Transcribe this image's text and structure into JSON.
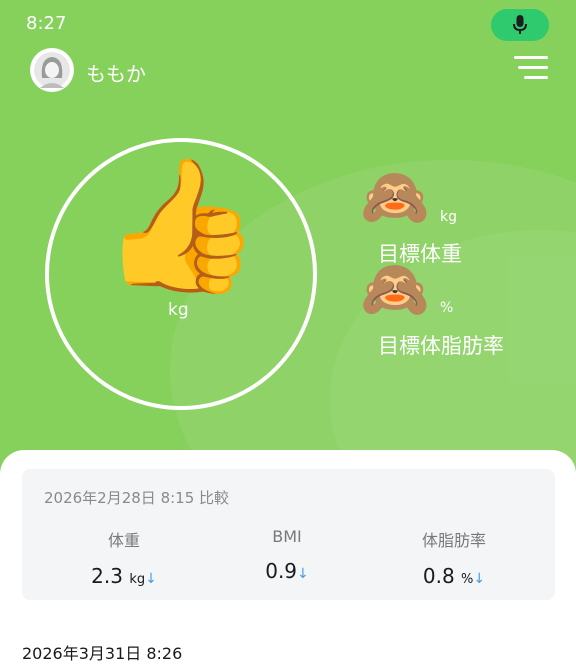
{
  "status": {
    "time": "8:27"
  },
  "header": {
    "user_name": "ももか"
  },
  "summary": {
    "unit": "kg"
  },
  "goals": {
    "weight": {
      "unit": "kg",
      "label": "目標体重"
    },
    "body_fat": {
      "unit": "%",
      "label": "目標体脂肪率"
    }
  },
  "comparison": {
    "date_text": "2026年2月28日 8:15 比較",
    "items": [
      {
        "label": "体重",
        "value": "2.3",
        "unit": "kg",
        "arrow": "↓"
      },
      {
        "label": "BMI",
        "value": "0.9",
        "unit": "",
        "arrow": "↓"
      },
      {
        "label": "体脂肪率",
        "value": "0.8",
        "unit": "%",
        "arrow": "↓"
      }
    ]
  },
  "latest": {
    "date_text": "2026年3月31日 8:26"
  },
  "icons": {
    "center": "thumbs-up-icon",
    "goals": "see-no-evil-monkey-icon",
    "mic": "microphone-icon",
    "menu": "menu-icon"
  },
  "colors": {
    "header_green": "#86d05c",
    "mic_green": "#2fca6e",
    "decrease_arrow": "#4a9ce0"
  }
}
